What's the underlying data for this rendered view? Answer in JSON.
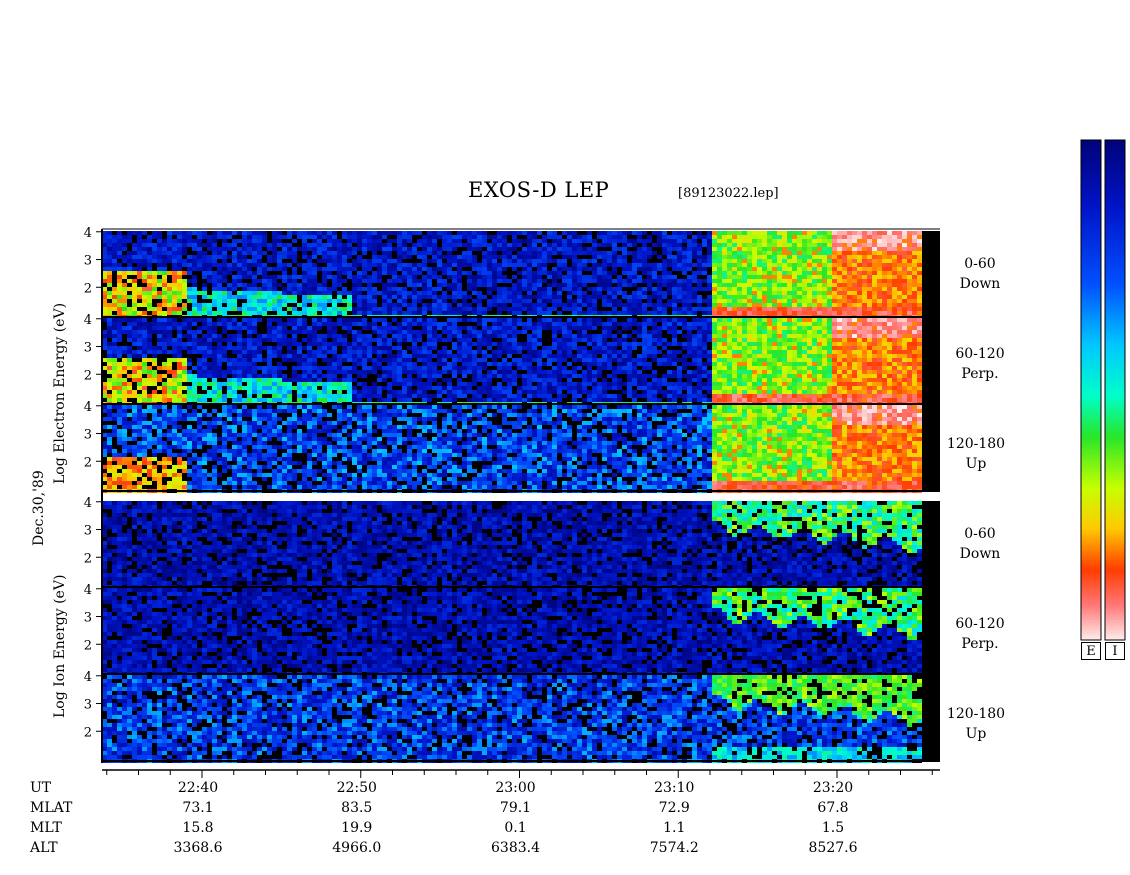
{
  "header": {
    "title": "EXOS-D LEP",
    "file": "[89123022.lep]"
  },
  "left_labels": {
    "electron": "Log  Electron  Energy (eV)",
    "ion": "Log  Ion  Energy (eV)",
    "date": "Dec.30,'89"
  },
  "panel_labels": [
    {
      "range": "0-60",
      "dir": "Down"
    },
    {
      "range": "60-120",
      "dir": "Perp."
    },
    {
      "range": "120-180",
      "dir": "Up"
    },
    {
      "range": "0-60",
      "dir": "Down"
    },
    {
      "range": "60-120",
      "dir": "Perp."
    },
    {
      "range": "120-180",
      "dir": "Up"
    }
  ],
  "y_ticks": [
    "4",
    "3",
    "2"
  ],
  "colorbar": {
    "labels": [
      "E",
      "I"
    ],
    "colors_top_to_bottom": [
      "#1a1a80",
      "#0000ff",
      "#0080ff",
      "#00ffff",
      "#00ff80",
      "#00cc00",
      "#ffff00",
      "#ff8000",
      "#ff0000",
      "#ffc0c0",
      "#ffffff"
    ]
  },
  "chart_data": {
    "type": "heatmap",
    "title": "EXOS-D LEP",
    "ylabel": "Log Energy (eV)",
    "y_range": [
      1,
      4
    ],
    "x_ticks": [
      "22:40",
      "22:50",
      "23:00",
      "23:10",
      "23:20"
    ],
    "orbit_table": {
      "rows": [
        {
          "name": "UT",
          "values": [
            "22:40",
            "22:50",
            "23:00",
            "23:10",
            "23:20"
          ]
        },
        {
          "name": "MLAT",
          "values": [
            "73.1",
            "83.5",
            "79.1",
            "72.9",
            "67.8"
          ]
        },
        {
          "name": "MLT",
          "values": [
            "15.8",
            "19.9",
            "0.1",
            "1.1",
            "1.5"
          ]
        },
        {
          "name": "ALT",
          "values": [
            "3368.6",
            "4966.0",
            "6383.4",
            "7574.2",
            "8527.6"
          ]
        }
      ]
    }
  }
}
